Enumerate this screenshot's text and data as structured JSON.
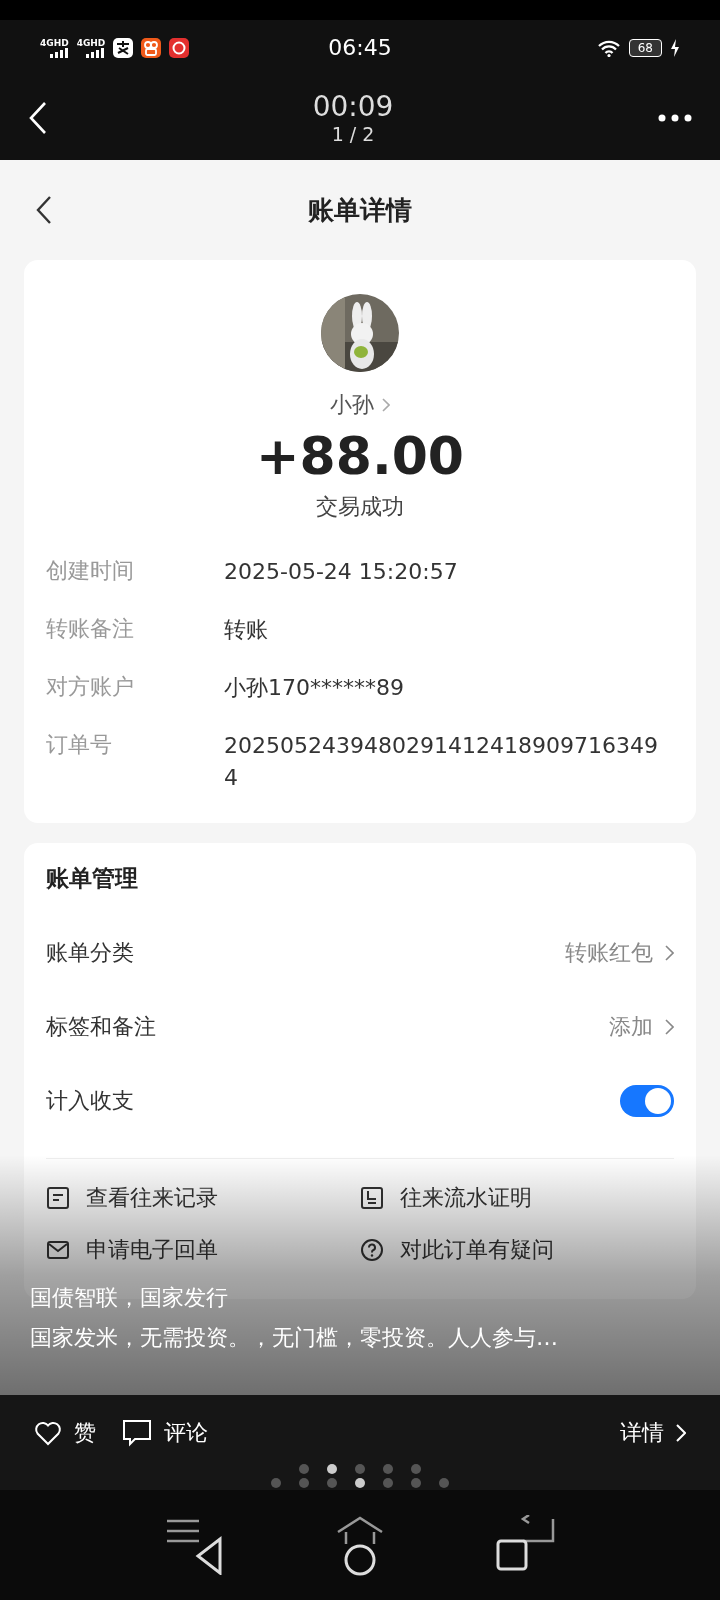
{
  "status_bar": {
    "signals": [
      "4GHD",
      "4GHD"
    ],
    "time": "06:45",
    "battery": "68",
    "charging": true
  },
  "viewer_header": {
    "elapsed": "00:09",
    "page": "1 / 2"
  },
  "page": {
    "title": "账单详情",
    "payee": {
      "name": "小孙",
      "amount": "+88.00",
      "status": "交易成功"
    },
    "details": [
      {
        "label": "创建时间",
        "value": "2025-05-24 15:20:57"
      },
      {
        "label": "转账备注",
        "value": "转账"
      },
      {
        "label": "对方账户",
        "value": "小孙170******89"
      },
      {
        "label": "订单号",
        "value": "20250524394802914124189097163494"
      }
    ],
    "management": {
      "title": "账单管理",
      "rows": [
        {
          "kind": "link",
          "label": "账单分类",
          "value": "转账红包"
        },
        {
          "kind": "link",
          "label": "标签和备注",
          "value": "添加"
        },
        {
          "kind": "toggle",
          "label": "计入收支",
          "on": true
        }
      ],
      "actions": [
        {
          "kind": "records",
          "label": "查看往来记录"
        },
        {
          "kind": "proof",
          "label": "往来流水证明"
        },
        {
          "kind": "receipt",
          "label": "申请电子回单"
        },
        {
          "kind": "question",
          "label": "对此订单有疑问"
        }
      ]
    }
  },
  "caption": {
    "title": "国债智联，国家发行",
    "text": "国家发米，无需投资。，无门槛，零投资。人人参与…"
  },
  "bottom_bar": {
    "like": "赞",
    "comment": "评论",
    "details": "详情",
    "dots_top": [
      {
        "selected": false
      },
      {
        "selected": true
      },
      {
        "selected": false
      },
      {
        "selected": false
      },
      {
        "selected": false
      }
    ],
    "dots_bottom": [
      {
        "selected": false
      },
      {
        "selected": false
      },
      {
        "selected": false
      },
      {
        "selected": true
      },
      {
        "selected": false
      },
      {
        "selected": false
      },
      {
        "selected": false
      }
    ]
  }
}
